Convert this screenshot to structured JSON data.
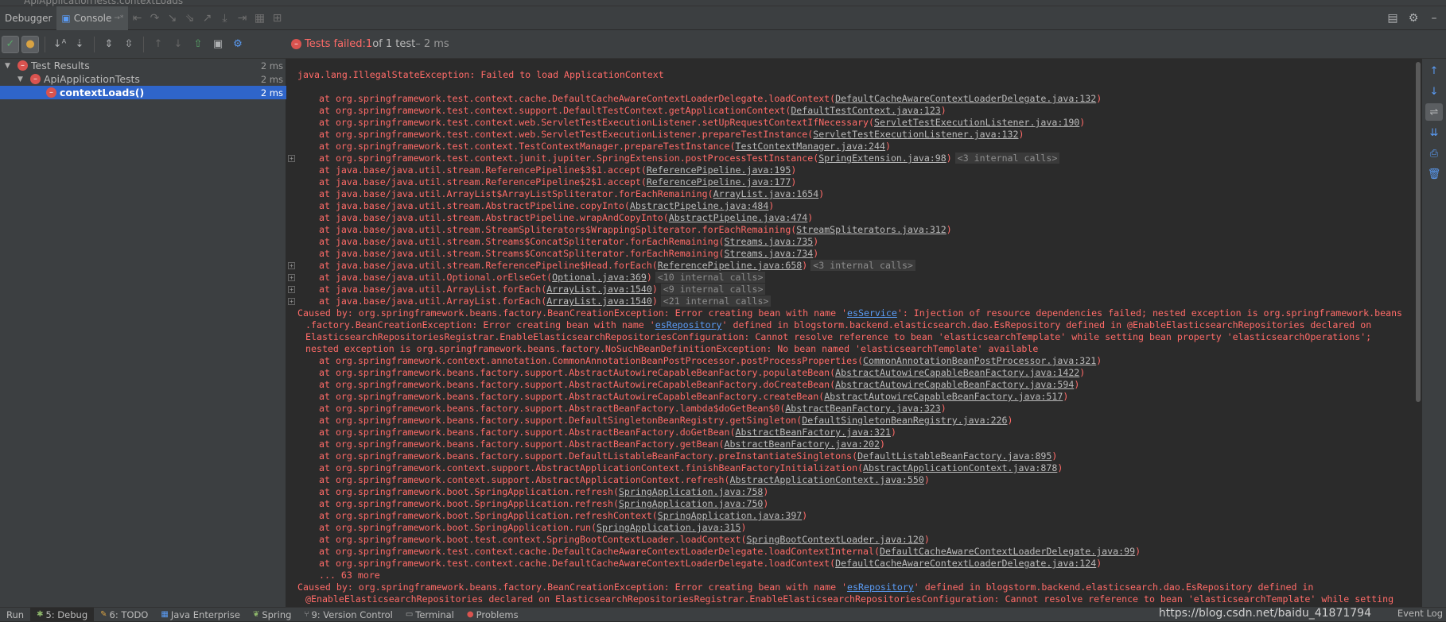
{
  "window": {
    "title_tab": "ApiApplicationTests.contextLoads"
  },
  "header": {
    "tabs": [
      {
        "label": "Debugger"
      },
      {
        "label": "Console"
      }
    ],
    "console_suffix": "→*"
  },
  "status": {
    "prefix": "Tests failed: ",
    "failed": "1",
    "of_text": " of 1 test",
    "time": " – 2 ms"
  },
  "tree": {
    "rows": [
      {
        "label": "Test Results",
        "time": "2 ms"
      },
      {
        "label": "ApiApplicationTests",
        "time": "2 ms"
      },
      {
        "label": "contextLoads()",
        "time": "2 ms"
      }
    ]
  },
  "console_lines": [
    {
      "k": "plain",
      "t": "java.lang.IllegalStateException: Failed to load ApplicationContext"
    },
    {
      "k": "blank"
    },
    {
      "k": "at",
      "pre": "at org.springframework.test.context.cache.DefaultCacheAwareContextLoaderDelegate.loadContext(",
      "link": "DefaultCacheAwareContextLoaderDelegate.java:132",
      "post": ")"
    },
    {
      "k": "at",
      "pre": "at org.springframework.test.context.support.DefaultTestContext.getApplicationContext(",
      "link": "DefaultTestContext.java:123",
      "post": ")"
    },
    {
      "k": "at",
      "pre": "at org.springframework.test.context.web.ServletTestExecutionListener.setUpRequestContextIfNecessary(",
      "link": "ServletTestExecutionListener.java:190",
      "post": ")"
    },
    {
      "k": "at",
      "pre": "at org.springframework.test.context.web.ServletTestExecutionListener.prepareTestInstance(",
      "link": "ServletTestExecutionListener.java:132",
      "post": ")"
    },
    {
      "k": "at",
      "pre": "at org.springframework.test.context.TestContextManager.prepareTestInstance(",
      "link": "TestContextManager.java:244",
      "post": ")"
    },
    {
      "k": "at",
      "fold": true,
      "pre": "at org.springframework.test.context.junit.jupiter.SpringExtension.postProcessTestInstance(",
      "link": "SpringExtension.java:98",
      "post": ")",
      "internal": "<3 internal calls>"
    },
    {
      "k": "at",
      "pre": "at java.base/java.util.stream.ReferencePipeline$3$1.accept(",
      "link": "ReferencePipeline.java:195",
      "post": ")"
    },
    {
      "k": "at",
      "pre": "at java.base/java.util.stream.ReferencePipeline$2$1.accept(",
      "link": "ReferencePipeline.java:177",
      "post": ")"
    },
    {
      "k": "at",
      "pre": "at java.base/java.util.ArrayList$ArrayListSpliterator.forEachRemaining(",
      "link": "ArrayList.java:1654",
      "post": ")"
    },
    {
      "k": "at",
      "pre": "at java.base/java.util.stream.AbstractPipeline.copyInto(",
      "link": "AbstractPipeline.java:484",
      "post": ")"
    },
    {
      "k": "at",
      "pre": "at java.base/java.util.stream.AbstractPipeline.wrapAndCopyInto(",
      "link": "AbstractPipeline.java:474",
      "post": ")"
    },
    {
      "k": "at",
      "pre": "at java.base/java.util.stream.StreamSpliterators$WrappingSpliterator.forEachRemaining(",
      "link": "StreamSpliterators.java:312",
      "post": ")"
    },
    {
      "k": "at",
      "pre": "at java.base/java.util.stream.Streams$ConcatSpliterator.forEachRemaining(",
      "link": "Streams.java:735",
      "post": ")"
    },
    {
      "k": "at",
      "pre": "at java.base/java.util.stream.Streams$ConcatSpliterator.forEachRemaining(",
      "link": "Streams.java:734",
      "post": ")"
    },
    {
      "k": "at",
      "fold": true,
      "pre": "at java.base/java.util.stream.ReferencePipeline$Head.forEach(",
      "link": "ReferencePipeline.java:658",
      "post": ")",
      "internal": "<3 internal calls>"
    },
    {
      "k": "at",
      "fold": true,
      "pre": "at java.base/java.util.Optional.orElseGet(",
      "link": "Optional.java:369",
      "post": ")",
      "internal": "<10 internal calls>"
    },
    {
      "k": "at",
      "fold": true,
      "pre": "at java.base/java.util.ArrayList.forEach(",
      "link": "ArrayList.java:1540",
      "post": ")",
      "internal": "<9 internal calls>"
    },
    {
      "k": "at",
      "fold": true,
      "pre": "at java.base/java.util.ArrayList.forEach(",
      "link": "ArrayList.java:1540",
      "post": ")",
      "internal": "<21 internal calls>"
    },
    {
      "k": "plain",
      "pre": "Caused by: org.springframework.beans.factory.BeanCreationException: Error creating bean with name '",
      "blue": "esService",
      "post": "': Injection of resource dependencies failed; nested exception is org.springframework.beans"
    },
    {
      "k": "cont",
      "pre": ".factory.BeanCreationException: Error creating bean with name '",
      "blue": "esRepository",
      "post": "' defined in blogstorm.backend.elasticsearch.dao.EsRepository defined in @EnableElasticsearchRepositories declared on"
    },
    {
      "k": "cont",
      "t": "ElasticsearchRepositoriesRegistrar.EnableElasticsearchRepositoriesConfiguration: Cannot resolve reference to bean 'elasticsearchTemplate' while setting bean property 'elasticsearchOperations';"
    },
    {
      "k": "cont",
      "t": "nested exception is org.springframework.beans.factory.NoSuchBeanDefinitionException: No bean named 'elasticsearchTemplate' available"
    },
    {
      "k": "at",
      "pre": "at org.springframework.context.annotation.CommonAnnotationBeanPostProcessor.postProcessProperties(",
      "link": "CommonAnnotationBeanPostProcessor.java:321",
      "post": ")"
    },
    {
      "k": "at",
      "pre": "at org.springframework.beans.factory.support.AbstractAutowireCapableBeanFactory.populateBean(",
      "link": "AbstractAutowireCapableBeanFactory.java:1422",
      "post": ")"
    },
    {
      "k": "at",
      "pre": "at org.springframework.beans.factory.support.AbstractAutowireCapableBeanFactory.doCreateBean(",
      "link": "AbstractAutowireCapableBeanFactory.java:594",
      "post": ")"
    },
    {
      "k": "at",
      "pre": "at org.springframework.beans.factory.support.AbstractAutowireCapableBeanFactory.createBean(",
      "link": "AbstractAutowireCapableBeanFactory.java:517",
      "post": ")"
    },
    {
      "k": "at",
      "pre": "at org.springframework.beans.factory.support.AbstractBeanFactory.lambda$doGetBean$0(",
      "link": "AbstractBeanFactory.java:323",
      "post": ")"
    },
    {
      "k": "at",
      "pre": "at org.springframework.beans.factory.support.DefaultSingletonBeanRegistry.getSingleton(",
      "link": "DefaultSingletonBeanRegistry.java:226",
      "post": ")"
    },
    {
      "k": "at",
      "pre": "at org.springframework.beans.factory.support.AbstractBeanFactory.doGetBean(",
      "link": "AbstractBeanFactory.java:321",
      "post": ")"
    },
    {
      "k": "at",
      "pre": "at org.springframework.beans.factory.support.AbstractBeanFactory.getBean(",
      "link": "AbstractBeanFactory.java:202",
      "post": ")"
    },
    {
      "k": "at",
      "pre": "at org.springframework.beans.factory.support.DefaultListableBeanFactory.preInstantiateSingletons(",
      "link": "DefaultListableBeanFactory.java:895",
      "post": ")"
    },
    {
      "k": "at",
      "pre": "at org.springframework.context.support.AbstractApplicationContext.finishBeanFactoryInitialization(",
      "link": "AbstractApplicationContext.java:878",
      "post": ")"
    },
    {
      "k": "at",
      "pre": "at org.springframework.context.support.AbstractApplicationContext.refresh(",
      "link": "AbstractApplicationContext.java:550",
      "post": ")"
    },
    {
      "k": "at",
      "pre": "at org.springframework.boot.SpringApplication.refresh(",
      "link": "SpringApplication.java:758",
      "post": ")"
    },
    {
      "k": "at",
      "pre": "at org.springframework.boot.SpringApplication.refresh(",
      "link": "SpringApplication.java:750",
      "post": ")"
    },
    {
      "k": "at",
      "pre": "at org.springframework.boot.SpringApplication.refreshContext(",
      "link": "SpringApplication.java:397",
      "post": ")"
    },
    {
      "k": "at",
      "pre": "at org.springframework.boot.SpringApplication.run(",
      "link": "SpringApplication.java:315",
      "post": ")"
    },
    {
      "k": "at",
      "pre": "at org.springframework.boot.test.context.SpringBootContextLoader.loadContext(",
      "link": "SpringBootContextLoader.java:120",
      "post": ")"
    },
    {
      "k": "at",
      "pre": "at org.springframework.test.context.cache.DefaultCacheAwareContextLoaderDelegate.loadContextInternal(",
      "link": "DefaultCacheAwareContextLoaderDelegate.java:99",
      "post": ")"
    },
    {
      "k": "at",
      "pre": "at org.springframework.test.context.cache.DefaultCacheAwareContextLoaderDelegate.loadContext(",
      "link": "DefaultCacheAwareContextLoaderDelegate.java:124",
      "post": ")"
    },
    {
      "k": "at",
      "t": "... 63 more"
    },
    {
      "k": "plain",
      "pre": "Caused by: org.springframework.beans.factory.BeanCreationException: Error creating bean with name '",
      "blue": "esRepository",
      "post": "' defined in blogstorm.backend.elasticsearch.dao.EsRepository defined in"
    },
    {
      "k": "cont",
      "t": "@EnableElasticsearchRepositories declared on ElasticsearchRepositoriesRegistrar.EnableElasticsearchRepositoriesConfiguration: Cannot resolve reference to bean 'elasticsearchTemplate' while setting"
    }
  ],
  "bottom": {
    "items": [
      {
        "label": "Run",
        "icon": "run-icon"
      },
      {
        "label": "5: Debug",
        "icon": "debug-icon"
      },
      {
        "label": "6: TODO",
        "icon": "todo-icon"
      },
      {
        "label": "Java Enterprise",
        "icon": "java-enterprise-icon"
      },
      {
        "label": "Spring",
        "icon": "spring-icon"
      },
      {
        "label": "9: Version Control",
        "icon": "vcs-icon"
      },
      {
        "label": "Terminal",
        "icon": "terminal-icon"
      },
      {
        "label": "Problems",
        "icon": "problems-icon"
      }
    ],
    "watermark": "https://blog.csdn.net/baidu_41871794",
    "event_log": "Event Log"
  }
}
